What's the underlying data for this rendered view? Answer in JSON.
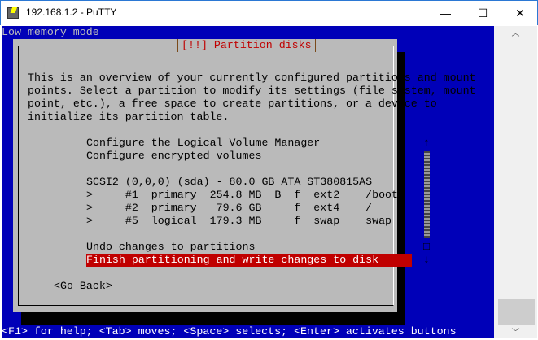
{
  "window": {
    "title": "192.168.1.2 - PuTTY",
    "minimize": "—",
    "maximize": "☐",
    "close": "✕"
  },
  "terminal": {
    "top_status": "Low memory mode",
    "dialog": {
      "title": "[!!] Partition disks",
      "description": [
        "This is an overview of your currently configured partitions and mount",
        "points. Select a partition to modify its settings (file system, mount",
        "point, etc.), a free space to create partitions, or a device to",
        "initialize its partition table."
      ],
      "items": [
        "Configure the Logical Volume Manager",
        "Configure encrypted volumes",
        "SCSI2 (0,0,0) (sda) - 80.0 GB ATA ST380815AS",
        ">     #1  primary  254.8 MB  B  f  ext2    /boot",
        ">     #2  primary   79.6 GB     f  ext4    /",
        ">     #5  logical  179.3 MB     f  swap    swap",
        "Undo changes to partitions",
        "Finish partitioning and write changes to disk"
      ],
      "selected_index": 7,
      "go_back": "<Go Back>",
      "scroll_up": "↑",
      "scroll_down": "↓",
      "scroll_marker": "□"
    },
    "bottom_status": "<F1> for help; <Tab> moves; <Space> selects; <Enter> activates buttons"
  },
  "scrollbar": {
    "up": "︿",
    "down": "﹀"
  }
}
